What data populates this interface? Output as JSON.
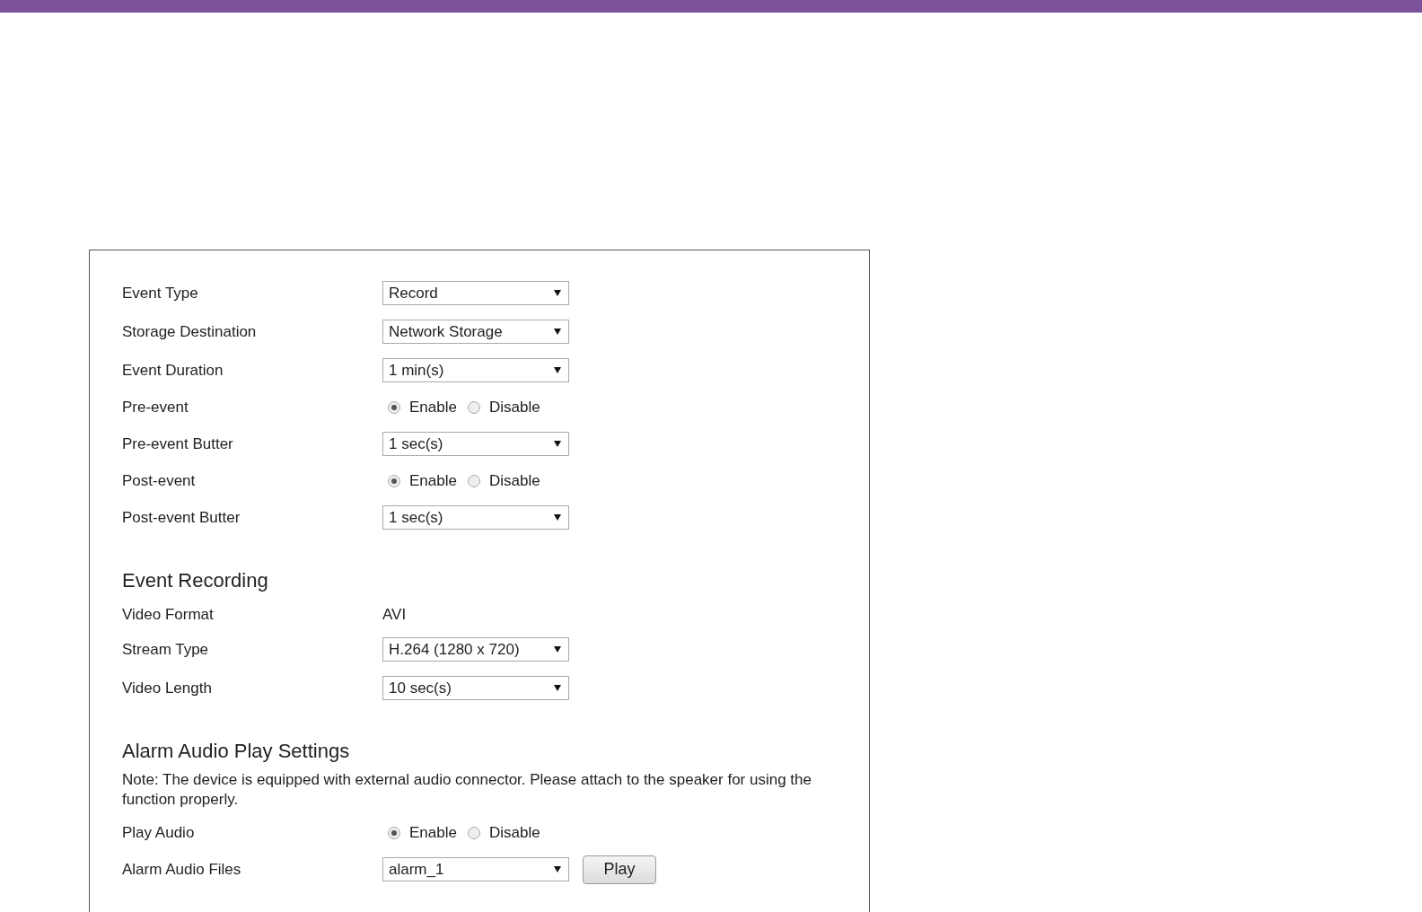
{
  "sections": [
    {
      "rows": [
        {
          "kind": "select",
          "label": "Event Type",
          "value": "Record"
        },
        {
          "kind": "select",
          "label": "Storage Destination",
          "value": "Network Storage"
        },
        {
          "kind": "select",
          "label": "Event Duration",
          "value": "1 min(s)"
        },
        {
          "kind": "radio",
          "label": "Pre-event",
          "options": [
            {
              "label": "Enable",
              "selected": true
            },
            {
              "label": "Disable",
              "selected": false
            }
          ]
        },
        {
          "kind": "select",
          "label": "Pre-event Butter",
          "value": "1 sec(s)"
        },
        {
          "kind": "radio",
          "label": "Post-event",
          "options": [
            {
              "label": "Enable",
              "selected": true
            },
            {
              "label": "Disable",
              "selected": false
            }
          ]
        },
        {
          "kind": "select",
          "label": "Post-event Butter",
          "value": "1 sec(s)"
        }
      ]
    },
    {
      "heading": "Event Recording",
      "rows": [
        {
          "kind": "text",
          "label": "Video Format",
          "value": "AVI"
        },
        {
          "kind": "select",
          "label": "Stream Type",
          "value": "H.264 (1280 x 720)"
        },
        {
          "kind": "select",
          "label": "Video Length",
          "value": "10 sec(s)"
        }
      ]
    },
    {
      "heading": "Alarm Audio Play Settings",
      "note": "Note: The device is equipped with external audio connector. Please attach to the speaker for using the function properly.",
      "rows": [
        {
          "kind": "radio",
          "label": "Play Audio",
          "options": [
            {
              "label": "Enable",
              "selected": true
            },
            {
              "label": "Disable",
              "selected": false
            }
          ]
        },
        {
          "kind": "select",
          "label": "Alarm Audio Files",
          "value": "alarm_1",
          "button": "Play"
        }
      ]
    }
  ]
}
